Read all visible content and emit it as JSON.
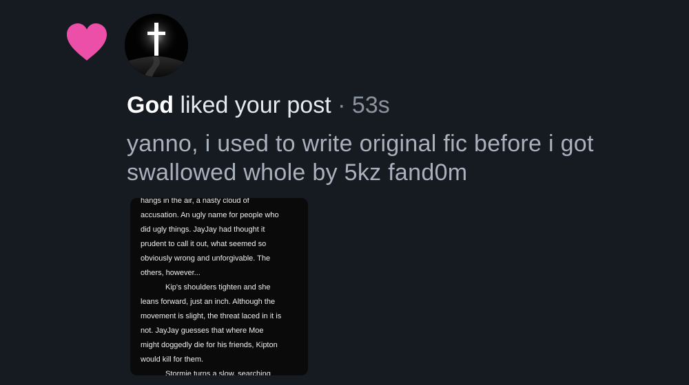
{
  "notification": {
    "actor": "God",
    "action": "liked your post",
    "separator": "·",
    "time": "53s",
    "heart_color": "#ec4fa7",
    "heart_icon": "heart-icon",
    "avatar_icon": "glowing-cross-icon"
  },
  "post": {
    "text": "yanno, i used to write original fic before i got swallowed whole by 5kz fand0m"
  },
  "thumbnail": {
    "paragraphs": [
      {
        "indent": false,
        "lines": [
          "hangs in the air, a nasty cloud of",
          "accusation. An ugly name for people who",
          "did ugly things. JayJay had thought it",
          "prudent to call it out, what seemed so",
          "obviously wrong and unforgivable. The",
          "others, however..."
        ]
      },
      {
        "indent": true,
        "lines": [
          "Kip's shoulders tighten and she",
          "leans forward, just an inch. Although the",
          "movement is slight, the threat laced in it is",
          "not. JayJay guesses that where Moe",
          "might doggedly die for his friends, Kipton",
          "would kill for them."
        ]
      },
      {
        "indent": true,
        "lines": [
          "Stormie turns a slow, searching"
        ]
      }
    ]
  }
}
